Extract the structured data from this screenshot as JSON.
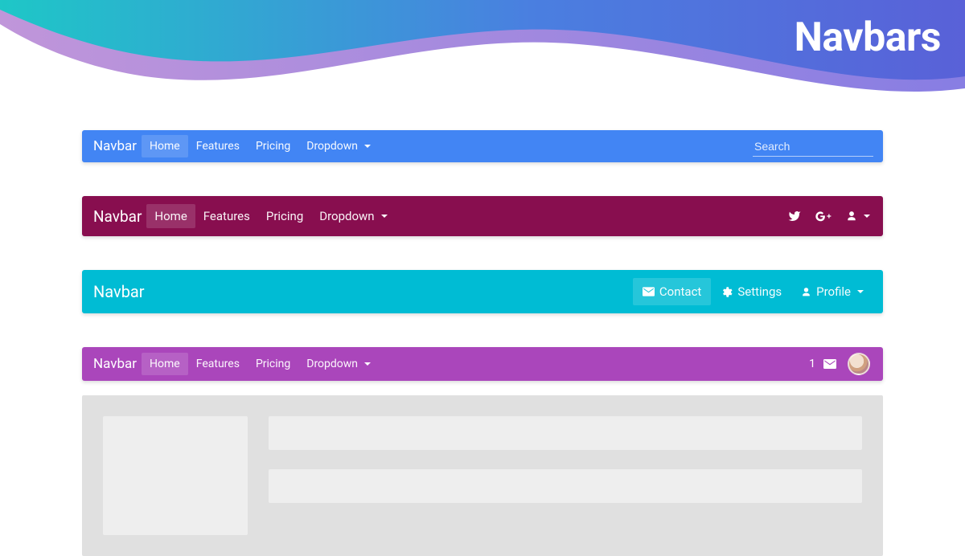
{
  "hero_title": "Navbars",
  "colors": {
    "blue": "#4285f4",
    "wine": "#880e4f",
    "cyan": "#00bcd4",
    "purple": "#aa46bb"
  },
  "navbars": {
    "blue": {
      "brand": "Navbar",
      "items": [
        "Home",
        "Features",
        "Pricing",
        "Dropdown"
      ],
      "active_index": 0,
      "dropdown_index": 3,
      "search_placeholder": "Search"
    },
    "wine": {
      "brand": "Navbar",
      "items": [
        "Home",
        "Features",
        "Pricing",
        "Dropdown"
      ],
      "active_index": 0,
      "dropdown_index": 3,
      "right_icons": [
        "twitter",
        "google-plus",
        "user"
      ]
    },
    "cyan": {
      "brand": "Navbar",
      "right_items": [
        {
          "icon": "envelope",
          "label": "Contact",
          "highlight": true
        },
        {
          "icon": "gear",
          "label": "Settings"
        },
        {
          "icon": "user",
          "label": "Profile",
          "dropdown": true
        }
      ]
    },
    "purple": {
      "brand": "Navbar",
      "items": [
        "Home",
        "Features",
        "Pricing",
        "Dropdown"
      ],
      "active_index": 0,
      "dropdown_index": 3,
      "notification_count": 1
    }
  }
}
